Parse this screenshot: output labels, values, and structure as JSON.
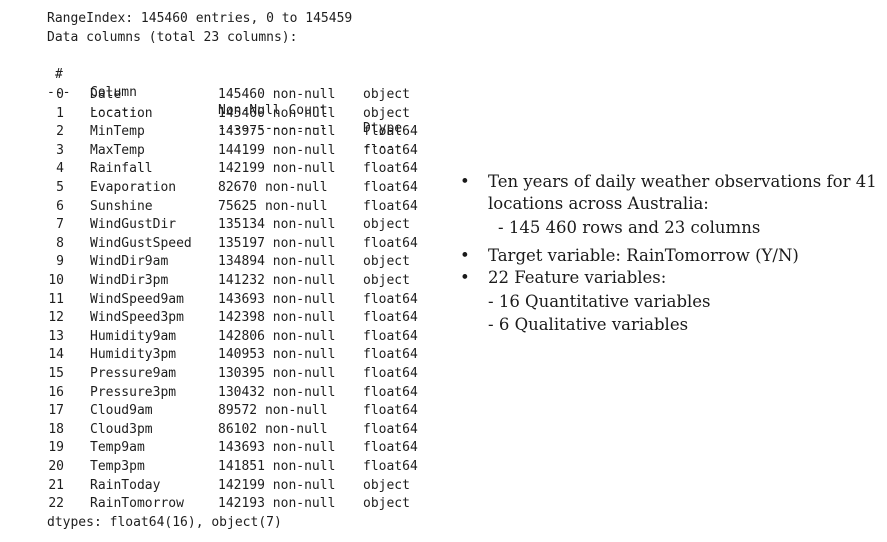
{
  "header": {
    "range_index": "RangeIndex: 145460 entries, 0 to 145459",
    "data_columns": "Data columns (total 23 columns):",
    "col_hash": "#",
    "col_column": "Column",
    "col_count": "Non-Null Count",
    "col_dtype": "Dtype",
    "dash_hash": "---",
    "dash_column": "------",
    "dash_count": "--------------",
    "dash_dtype": "-----"
  },
  "rows": [
    {
      "idx": "0",
      "name": "Date",
      "count": "145460 non-null",
      "dtype": "object"
    },
    {
      "idx": "1",
      "name": "Location",
      "count": "145460 non-null",
      "dtype": "object"
    },
    {
      "idx": "2",
      "name": "MinTemp",
      "count": "143975 non-null",
      "dtype": "float64"
    },
    {
      "idx": "3",
      "name": "MaxTemp",
      "count": "144199 non-null",
      "dtype": "float64"
    },
    {
      "idx": "4",
      "name": "Rainfall",
      "count": "142199 non-null",
      "dtype": "float64"
    },
    {
      "idx": "5",
      "name": "Evaporation",
      "count": "82670 non-null",
      "dtype": "float64"
    },
    {
      "idx": "6",
      "name": "Sunshine",
      "count": "75625 non-null",
      "dtype": "float64"
    },
    {
      "idx": "7",
      "name": "WindGustDir",
      "count": "135134 non-null",
      "dtype": "object"
    },
    {
      "idx": "8",
      "name": "WindGustSpeed",
      "count": "135197 non-null",
      "dtype": "float64"
    },
    {
      "idx": "9",
      "name": "WindDir9am",
      "count": "134894 non-null",
      "dtype": "object"
    },
    {
      "idx": "10",
      "name": "WindDir3pm",
      "count": "141232 non-null",
      "dtype": "object"
    },
    {
      "idx": "11",
      "name": "WindSpeed9am",
      "count": "143693 non-null",
      "dtype": "float64"
    },
    {
      "idx": "12",
      "name": "WindSpeed3pm",
      "count": "142398 non-null",
      "dtype": "float64"
    },
    {
      "idx": "13",
      "name": "Humidity9am",
      "count": "142806 non-null",
      "dtype": "float64"
    },
    {
      "idx": "14",
      "name": "Humidity3pm",
      "count": "140953 non-null",
      "dtype": "float64"
    },
    {
      "idx": "15",
      "name": "Pressure9am",
      "count": "130395 non-null",
      "dtype": "float64"
    },
    {
      "idx": "16",
      "name": "Pressure3pm",
      "count": "130432 non-null",
      "dtype": "float64"
    },
    {
      "idx": "17",
      "name": "Cloud9am",
      "count": "89572 non-null",
      "dtype": "float64"
    },
    {
      "idx": "18",
      "name": "Cloud3pm",
      "count": "86102 non-null",
      "dtype": "float64"
    },
    {
      "idx": "19",
      "name": "Temp9am",
      "count": "143693 non-null",
      "dtype": "float64"
    },
    {
      "idx": "20",
      "name": "Temp3pm",
      "count": "141851 non-null",
      "dtype": "float64"
    },
    {
      "idx": "21",
      "name": "RainToday",
      "count": "142199 non-null",
      "dtype": "object"
    },
    {
      "idx": "22",
      "name": "RainTomorrow",
      "count": "142193 non-null",
      "dtype": "object"
    }
  ],
  "footer": "dtypes: float64(16), object(7)",
  "notes": {
    "bullet": "•",
    "b1_line1": "Ten years of daily weather observations for 41",
    "b1_line2": "locations across Australia:",
    "b1_sub": "-  145 460 rows and 23 columns",
    "b2": "Target variable: RainTomorrow (Y/N)",
    "b3": "22 Feature variables:",
    "b3_sub1": "- 16 Quantitative variables",
    "b3_sub2": "-   6 Qualitative variables"
  }
}
